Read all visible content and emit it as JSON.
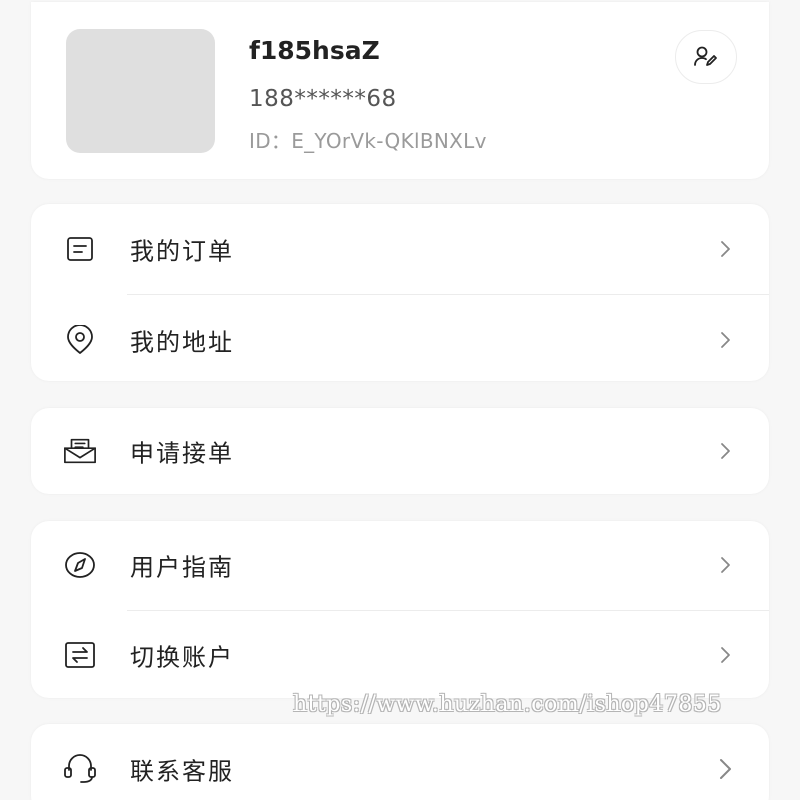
{
  "profile": {
    "username": "f185hsaZ",
    "phone": "188******68",
    "id_text": "ID：E_YOrVk-QKlBNXLv",
    "edit_icon": "user-edit-icon"
  },
  "menu_groups": [
    {
      "items": [
        {
          "label": "我的订单",
          "icon": "order-list-icon"
        },
        {
          "label": "我的地址",
          "icon": "location-pin-icon"
        }
      ]
    },
    {
      "items": [
        {
          "label": "申请接单",
          "icon": "inbox-mail-icon"
        }
      ]
    },
    {
      "items": [
        {
          "label": "用户指南",
          "icon": "compass-icon"
        },
        {
          "label": "切换账户",
          "icon": "switch-account-icon"
        }
      ]
    },
    {
      "items": [
        {
          "label": "联系客服",
          "icon": "headset-icon"
        }
      ]
    }
  ],
  "watermark": "https://www.huzhan.com/ishop47855",
  "colors": {
    "background": "#f7f7f7",
    "card": "#ffffff",
    "text_primary": "#222222",
    "text_secondary": "#555555",
    "text_muted": "#9a9a9a",
    "avatar_placeholder": "#dfdfdf"
  }
}
